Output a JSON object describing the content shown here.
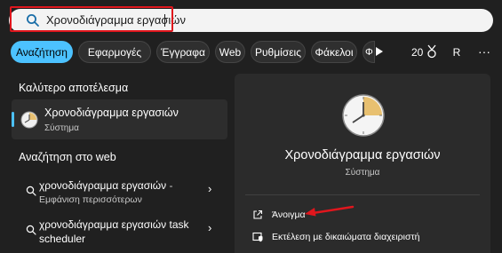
{
  "search": {
    "query": "Χρονοδιάγραμμα εργασιών",
    "icon": "search-icon"
  },
  "filters": {
    "tabs": [
      {
        "label": "Αναζήτηση",
        "active": true
      },
      {
        "label": "Εφαρμογές",
        "active": false
      },
      {
        "label": "Έγγραφα",
        "active": false
      },
      {
        "label": "Web",
        "active": false
      },
      {
        "label": "Ρυθμίσεις",
        "active": false
      },
      {
        "label": "Φάκελοι",
        "active": false
      }
    ],
    "points": "20",
    "avatar_letter": "R",
    "more": "···"
  },
  "best_match": {
    "heading": "Καλύτερο αποτέλεσμα",
    "title": "Χρονοδιάγραμμα εργασιών",
    "subtitle": "Σύστημα"
  },
  "web": {
    "heading": "Αναζήτηση στο web",
    "items": [
      {
        "title": "χρονοδιάγραμμα εργασιών",
        "suffix": " -",
        "subtitle": "Εμφάνιση περισσότερων"
      },
      {
        "title": "χρονοδιάγραμμα εργασιών task",
        "suffix": "",
        "subtitle": "scheduler"
      }
    ]
  },
  "detail": {
    "title": "Χρονοδιάγραμμα εργασιών",
    "subtitle": "Σύστημα",
    "actions": [
      {
        "label": "Άνοιγμα",
        "icon": "open-external-icon"
      },
      {
        "label": "Εκτέλεση με δικαιώματα διαχειριστή",
        "icon": "shield-admin-icon"
      }
    ]
  },
  "colors": {
    "accent": "#4cc2ff",
    "annotation": "#e0161d",
    "background": "#202020",
    "panel": "#2b2b2b"
  }
}
